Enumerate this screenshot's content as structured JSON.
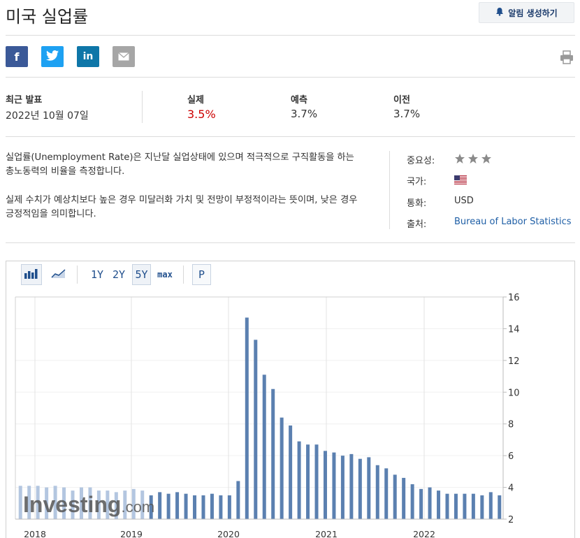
{
  "page": {
    "title": "미국 실업률",
    "alert_button": "알림 생성하기"
  },
  "share": [
    {
      "icon": "facebook-icon",
      "glyph": "f",
      "color": "#3b5998"
    },
    {
      "icon": "twitter-icon",
      "glyph": "t",
      "color": "#1da1f2"
    },
    {
      "icon": "linkedin-icon",
      "glyph": "in",
      "color": "#0e76a8"
    },
    {
      "icon": "email-icon",
      "glyph": "✉",
      "color": "#a6a6a6"
    }
  ],
  "release": {
    "latest_label": "최근 발표",
    "latest_date": "2022년 10월 07일",
    "actual_label": "실제",
    "actual_value": "3.5%",
    "actual_color": "#cc0000",
    "forecast_label": "예측",
    "forecast_value": "3.7%",
    "previous_label": "이전",
    "previous_value": "3.7%"
  },
  "description": {
    "p1": "실업률(Unemployment Rate)은 지난달 실업상태에 있으며 적극적으로 구직활동을 하는 총노동력의 비율을 측정합니다.",
    "p2": "실제 수치가 예상치보다 높은 경우 미달러화 가치 및 전망이 부정적이라는 뜻이며, 낮은 경우 긍정적임을 의미합니다."
  },
  "meta": {
    "importance_label": "중요성:",
    "importance_stars": 3,
    "country_label": "국가:",
    "country_icon": "us-flag-icon",
    "currency_label": "통화:",
    "currency_value": "USD",
    "source_label": "출처:",
    "source_value": "Bureau of Labor Statistics"
  },
  "toolbar": {
    "ranges": [
      "1Y",
      "2Y",
      "5Y",
      "max"
    ],
    "selected": "5Y",
    "p_label": "P"
  },
  "watermark": "Investing.com",
  "chart_data": {
    "type": "bar",
    "title": "",
    "ylim": [
      2,
      16
    ],
    "yticks": [
      2,
      4,
      6,
      8,
      10,
      12,
      14,
      16
    ],
    "xtick_labels": [
      "2018",
      "2019",
      "2020",
      "2021",
      "2022"
    ],
    "bar_color": "#5b80b0",
    "faded_bar_color": "#b3c6e0",
    "faded_count": 15,
    "values": [
      4.1,
      4.1,
      4.1,
      4.0,
      4.1,
      4.0,
      3.8,
      4.0,
      4.0,
      3.8,
      3.8,
      3.7,
      3.8,
      3.9,
      3.8,
      3.5,
      3.7,
      3.6,
      3.7,
      3.6,
      3.5,
      3.5,
      3.6,
      3.5,
      3.5,
      4.4,
      14.7,
      13.3,
      11.1,
      10.2,
      8.4,
      7.9,
      6.9,
      6.7,
      6.7,
      6.3,
      6.2,
      6.0,
      6.1,
      5.8,
      5.9,
      5.4,
      5.2,
      4.8,
      4.6,
      4.2,
      3.9,
      4.0,
      3.8,
      3.6,
      3.6,
      3.6,
      3.6,
      3.5,
      3.7,
      3.5
    ]
  }
}
